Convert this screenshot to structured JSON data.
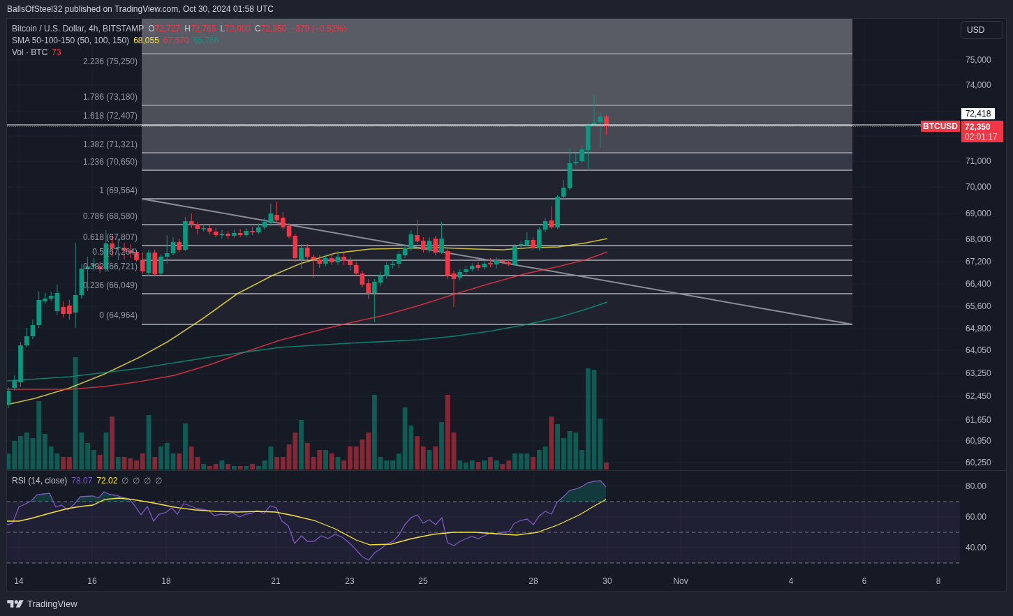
{
  "header": {
    "attribution": "BallsOfSteel32 published on TradingView.com, Oct 30, 2024 01:58 UTC"
  },
  "legend": {
    "symbol": "Bitcoin / U.S. Dollar, 4h, BITSTAMP",
    "falling": true,
    "ohlc": [
      {
        "key": "O",
        "value": "72,727"
      },
      {
        "key": "H",
        "value": "72,765"
      },
      {
        "key": "L",
        "value": "72,000"
      },
      {
        "key": "C",
        "value": "72,350"
      }
    ],
    "change": "−379 (−0.52%)"
  },
  "indicators": [
    {
      "kind": "sma",
      "name": "SMA 50-100-150 (50, 100, 150)",
      "values": [
        {
          "value": "68,055",
          "color": "#f7e536"
        },
        {
          "value": "67,570",
          "color": "#f23645"
        },
        {
          "value": "65,766",
          "color": "#089981"
        }
      ]
    },
    {
      "kind": "volume",
      "name": "Vol · BTC",
      "values": [
        {
          "value": "73",
          "color": "#f23645"
        }
      ]
    }
  ],
  "fib_levels": [
    {
      "label": "2.236 (75,250)"
    },
    {
      "label": "1.786 (73,180)"
    },
    {
      "label": "1.618 (72,407)"
    },
    {
      "label": "1.382 (71,321)"
    },
    {
      "label": "1.236 (70,650)"
    },
    {
      "label": "1 (69,564)"
    },
    {
      "label": "0.786 (68,580)"
    },
    {
      "label": "0.618 (67,807)"
    },
    {
      "label": "0.5 (67,264)"
    },
    {
      "label": "0.382 (66,721)"
    },
    {
      "label": "0.236 (66,049)"
    },
    {
      "label": "0 (64,964)"
    }
  ],
  "price_axis": {
    "currency": "USD",
    "ticks": [
      "75,000",
      "74,000",
      "71,000",
      "70,000",
      "69,000",
      "68,000",
      "67,200",
      "66,400",
      "65,600",
      "64,800",
      "64,050",
      "63,250",
      "62,450",
      "61,650",
      "60,950",
      "60,250"
    ],
    "line_label": "72,418",
    "last_price": {
      "symbol": "BTCUSD",
      "price": "72,350",
      "countdown": "02:01:17"
    }
  },
  "rsi": {
    "name": "RSI (14, close)",
    "values": [
      {
        "value": "78.07",
        "color": "#7e57c2"
      },
      {
        "value": "72.02",
        "color": "#f7e536"
      }
    ],
    "hidden_values": [
      "∅",
      "∅",
      "∅",
      "∅"
    ],
    "ticks": [
      "80.00",
      "60.00",
      "40.00"
    ]
  },
  "time_axis": {
    "ticks": [
      "14",
      "16",
      "18",
      "21",
      "23",
      "25",
      "28",
      "30",
      "Nov",
      "4",
      "6",
      "8"
    ]
  },
  "footer": {
    "brand": "TradingView"
  }
}
